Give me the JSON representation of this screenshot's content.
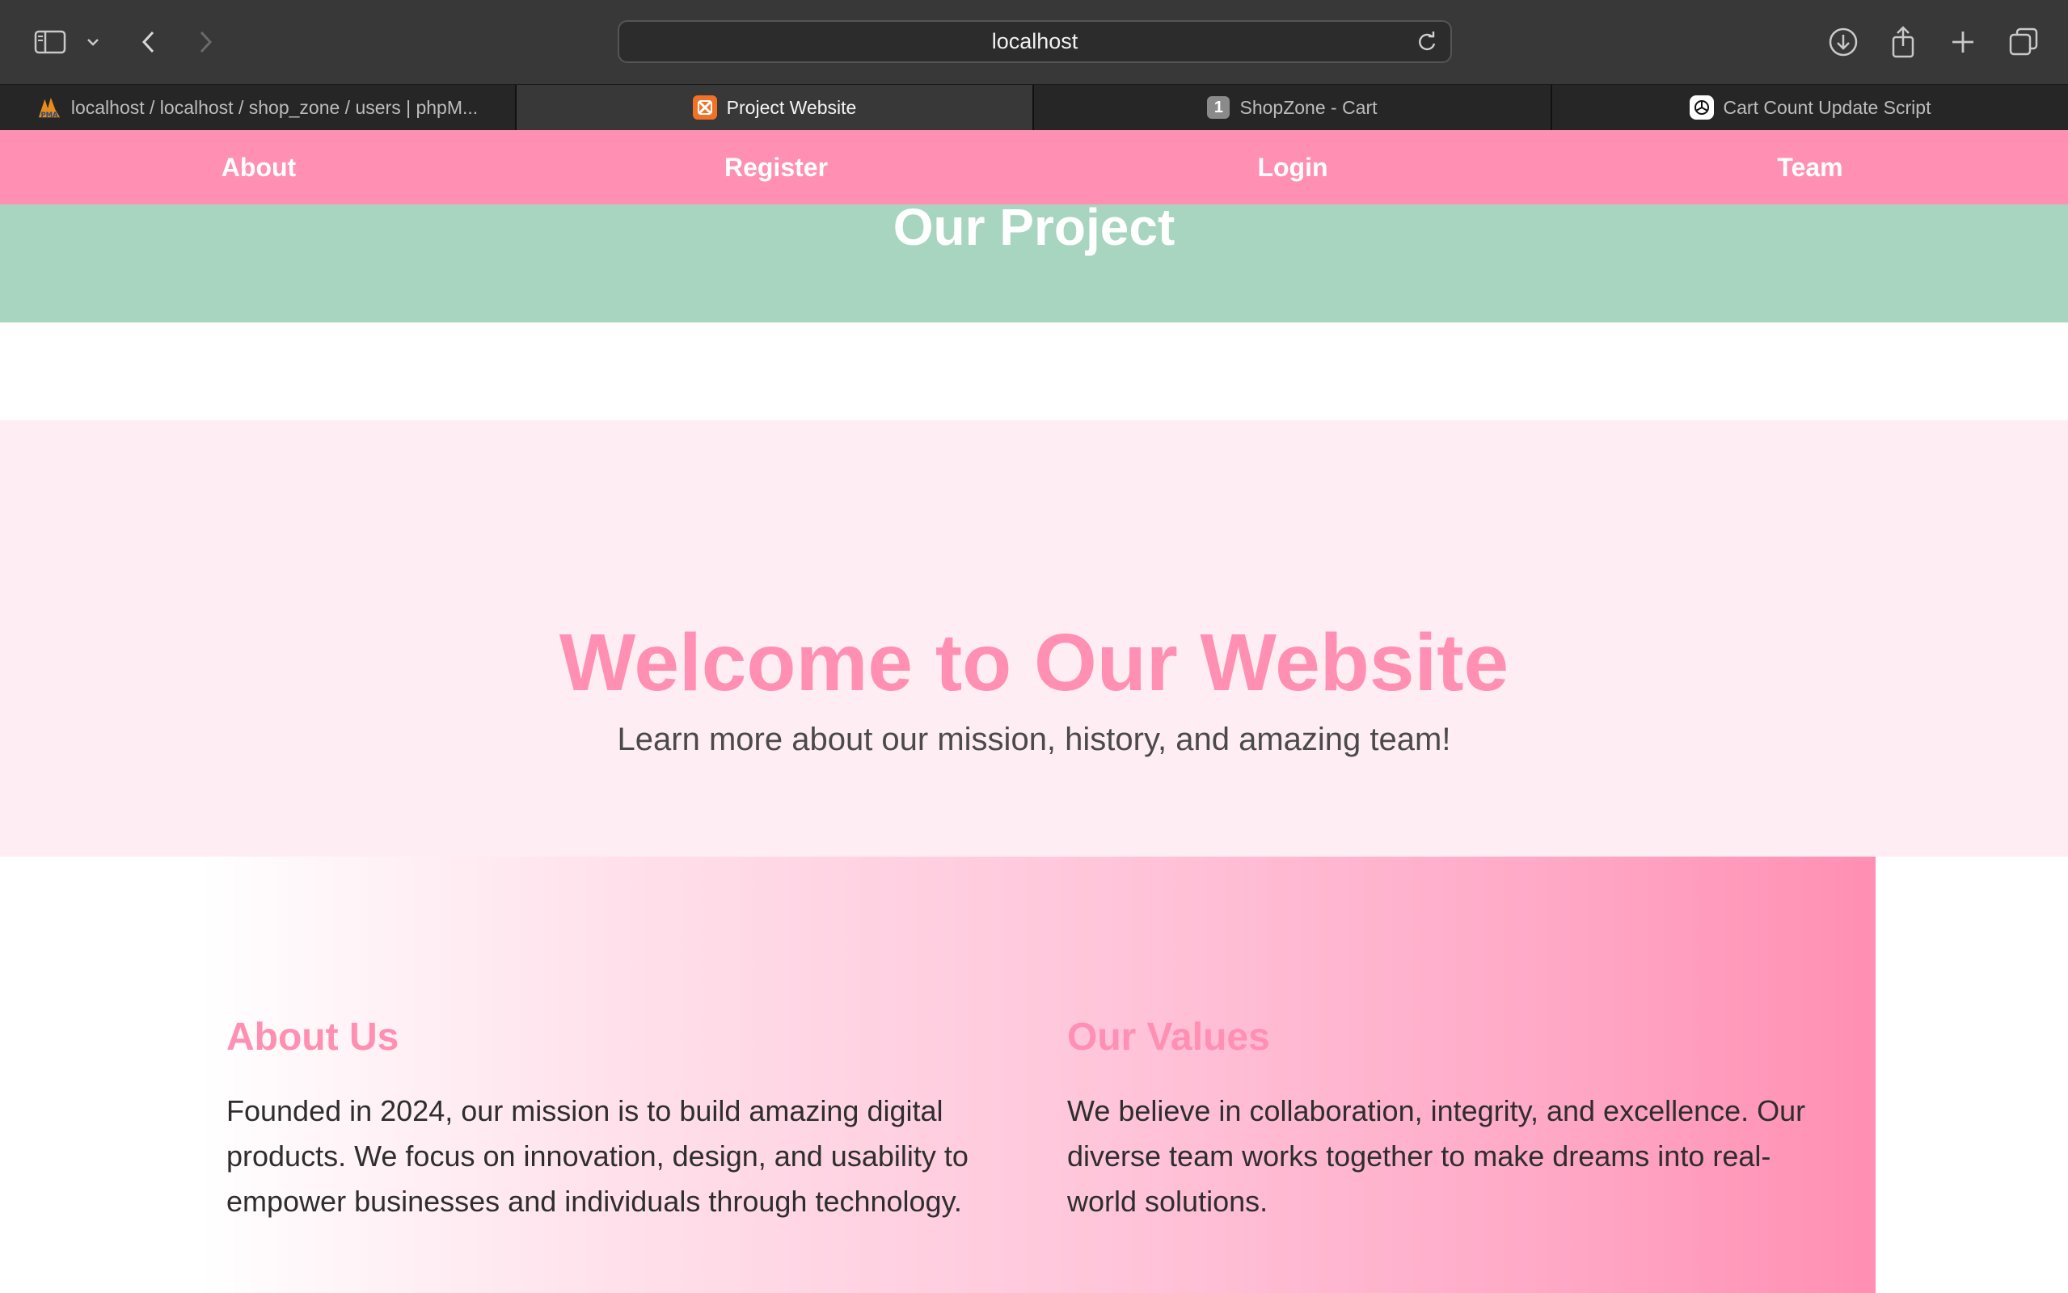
{
  "browser": {
    "url": "localhost",
    "tabs": [
      {
        "title": "localhost / localhost / shop_zone / users | phpM...",
        "icon": "phpmyadmin-icon",
        "active": false
      },
      {
        "title": "Project Website",
        "icon": "xampp-icon",
        "active": true
      },
      {
        "title": "ShopZone - Cart",
        "icon": "number-badge-icon",
        "badge": "1",
        "active": false
      },
      {
        "title": "Cart Count Update Script",
        "icon": "chatgpt-icon",
        "active": false
      }
    ]
  },
  "nav": {
    "items": [
      "About",
      "Register",
      "Login",
      "Team"
    ],
    "color": "#ff8fb3"
  },
  "header": {
    "title": "Our Project",
    "color": "#a8d5c0"
  },
  "hero": {
    "title": "Welcome to Our Website",
    "subtitle": "Learn more about our mission, history, and amazing team!",
    "background": "#ffedf4"
  },
  "info": {
    "about": {
      "heading": "About Us",
      "text": "Founded in 2024, our mission is to build amazing digital products. We focus on innovation, design, and usability to empower businesses and individuals through technology."
    },
    "values": {
      "heading": "Our Values",
      "text": "We believe in collaboration, integrity, and excellence. Our diverse team works together to make dreams into real-world solutions."
    }
  }
}
